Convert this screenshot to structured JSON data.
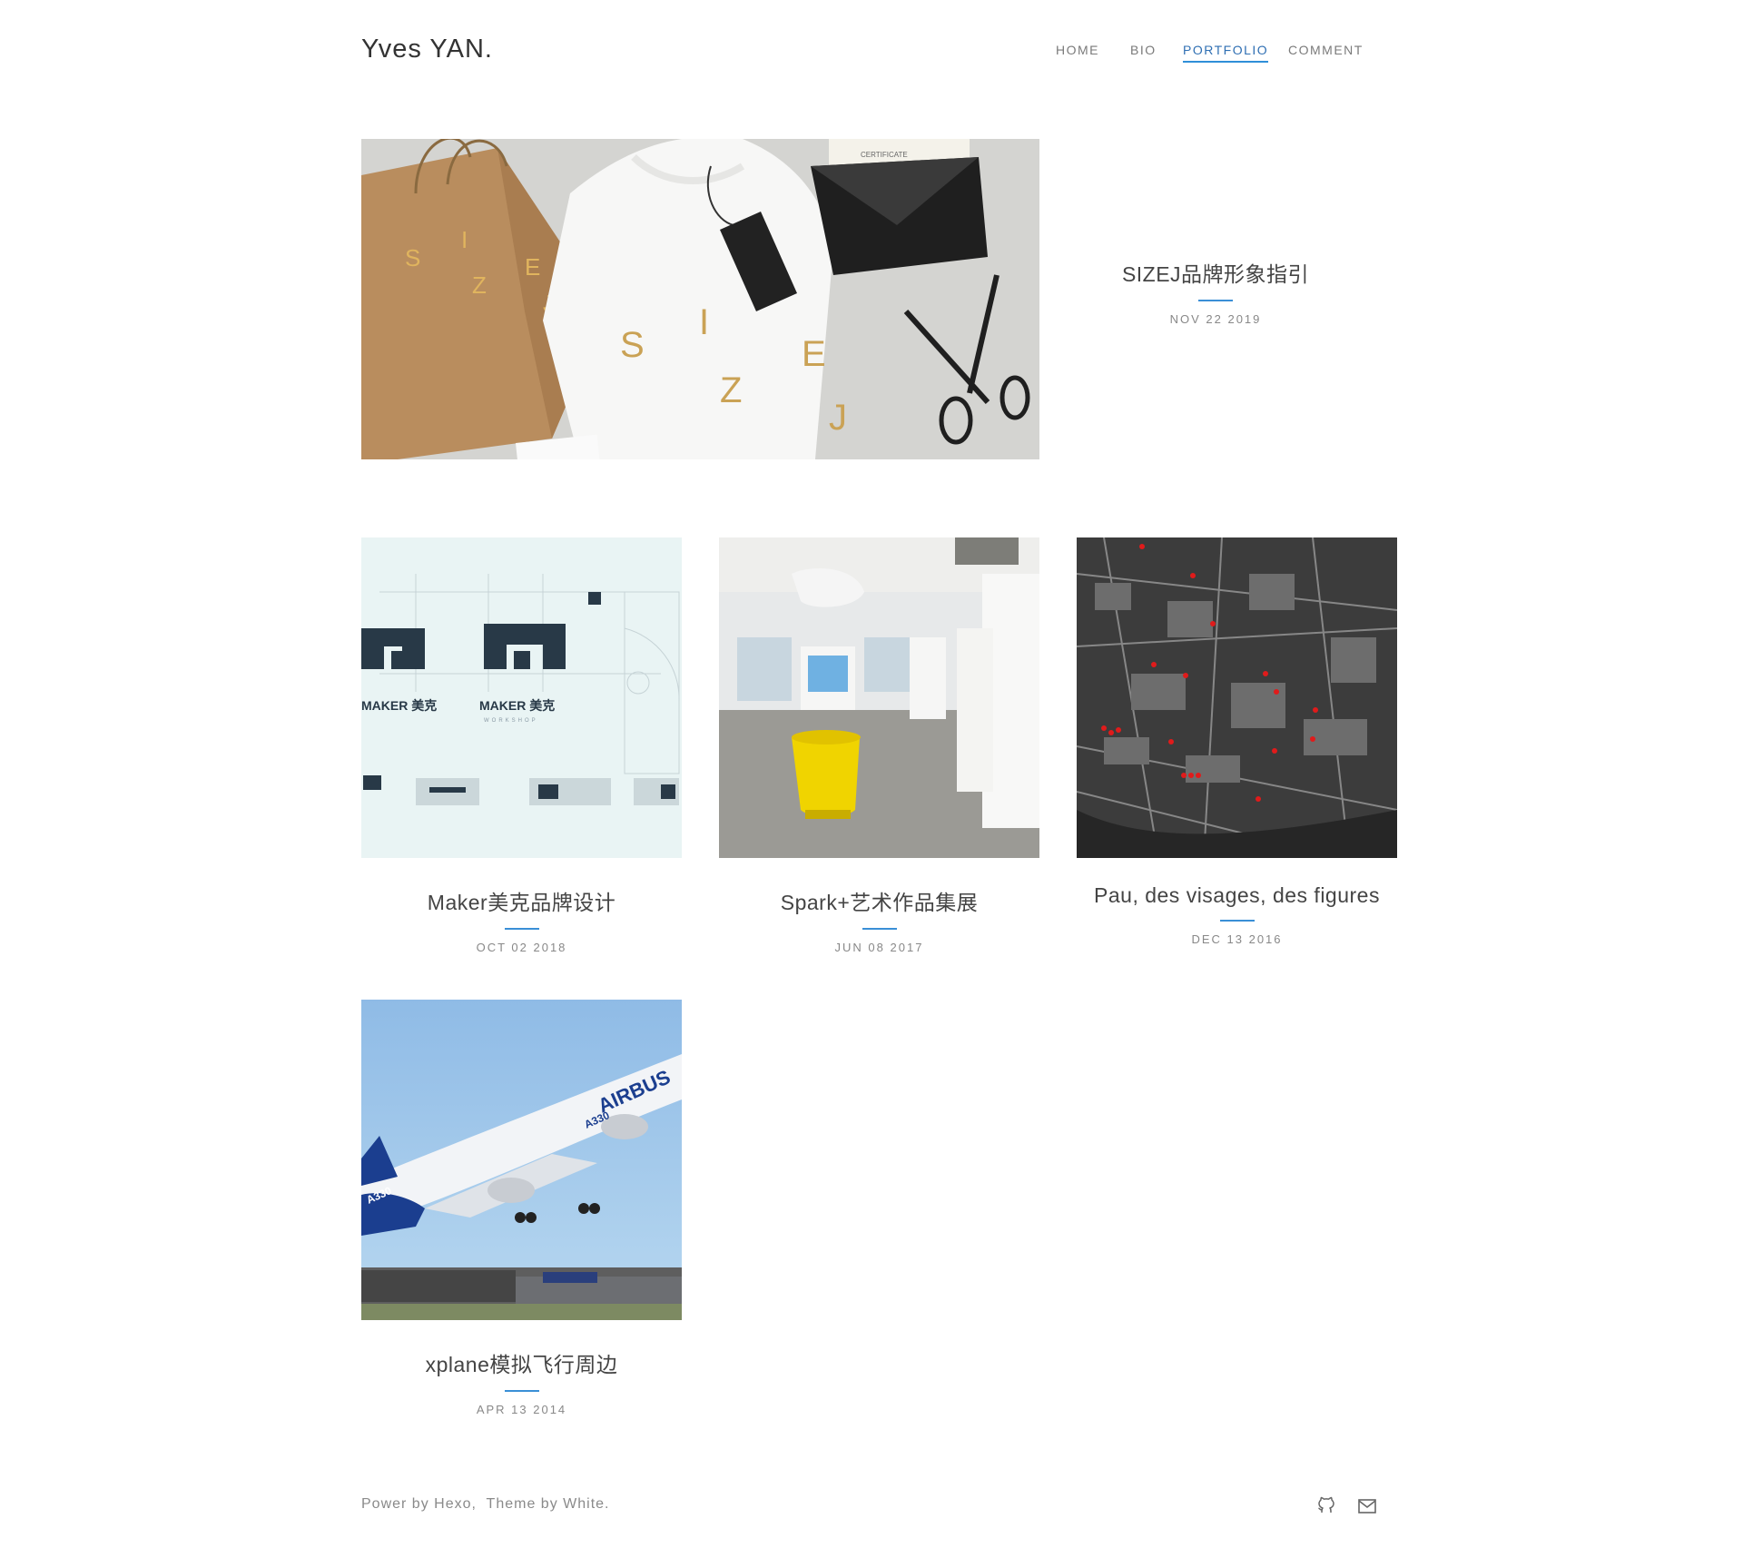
{
  "site": {
    "title": "Yves YAN."
  },
  "nav": {
    "items": [
      {
        "label": "HOME"
      },
      {
        "label": "BIO"
      },
      {
        "label": "PORTFOLIO",
        "active": true
      },
      {
        "label": "COMMENT"
      }
    ]
  },
  "featured": {
    "title": "SIZEJ品牌形象指引",
    "date": "NOV 22 2019",
    "image_text": {
      "s": "S",
      "i": "I",
      "z": "Z",
      "e": "E",
      "j": "J",
      "cert": "CERTIFICATE"
    }
  },
  "posts": [
    {
      "title": "Maker美克品牌设计",
      "date": "OCT 02 2018",
      "image_text": {
        "logo": "MAKER 美克",
        "sub": "WORKSHOP"
      }
    },
    {
      "title": "Spark+艺术作品集展",
      "date": "JUN 08 2017"
    },
    {
      "title": "Pau, des visages, des figures",
      "date": "DEC 13 2016"
    },
    {
      "title": "xplane模拟飞行周边",
      "date": "APR 13 2014",
      "image_text": {
        "brand": "AIRBUS",
        "model": "A330",
        "tail": "A330"
      }
    }
  ],
  "footer": {
    "power_prefix": "Power by ",
    "power_link": "Hexo",
    "separator": ",  ",
    "theme_prefix": "Theme by ",
    "theme_link": "White",
    "end": "."
  },
  "colors": {
    "accent": "#3a8fd6",
    "text": "#444444",
    "muted": "#888888"
  },
  "icons": [
    "github-icon",
    "mail-icon"
  ]
}
